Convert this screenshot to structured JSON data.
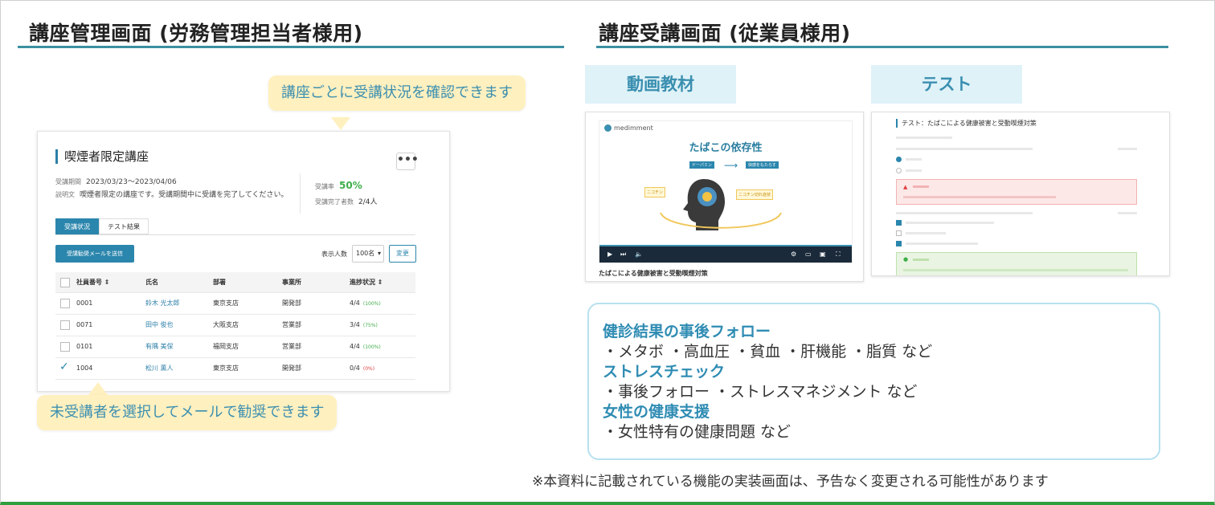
{
  "headings": {
    "admin": "講座管理画面 (労務管理担当者様用)",
    "employee": "講座受講画面 (従業員様用)"
  },
  "admin_card": {
    "course_title": "喫煙者限定講座",
    "more": "•••",
    "period_label": "受講期間",
    "period": "2023/03/23〜2023/04/06",
    "desc_label": "説明文",
    "desc": "喫煙者限定の講座です。受講期間中に受講を完了してください。",
    "rate_label": "受講率",
    "rate": "50%",
    "done_label": "受講完了者数",
    "done": "2/4人",
    "tabs": [
      "受講状況",
      "テスト結果"
    ],
    "mail_button": "受講勧奨メールを送信",
    "display_label": "表示人数",
    "display_value": "100名",
    "change_button": "変更",
    "columns": [
      "社員番号 ⇕",
      "氏名",
      "部署",
      "事業所",
      "進捗状況 ⇕"
    ],
    "rows": [
      {
        "id": "0001",
        "name": "鈴木 光太郎",
        "dept": "東京支店",
        "office": "開発部",
        "progress": "4/4",
        "pct": "(100%)",
        "checked": false
      },
      {
        "id": "0071",
        "name": "田中 俊也",
        "dept": "大阪支店",
        "office": "営業部",
        "progress": "3/4",
        "pct": "(75%)",
        "checked": false
      },
      {
        "id": "0101",
        "name": "有隅 美保",
        "dept": "福岡支店",
        "office": "営業部",
        "progress": "4/4",
        "pct": "(100%)",
        "checked": false
      },
      {
        "id": "1004",
        "name": "松川 薫人",
        "dept": "東京支店",
        "office": "開発部",
        "progress": "0/4",
        "pct": "(0%)",
        "checked": true
      }
    ]
  },
  "callouts": {
    "top": "講座ごとに受講状況を確認できます",
    "bottom": "未受講者を選択してメールで勧奨できます"
  },
  "labels": {
    "video": "動画教材",
    "test": "テスト"
  },
  "video": {
    "logo": "medimment",
    "title": "たばこの依存性",
    "tag1": "ドーパミン",
    "tag2": "快感をもたらす",
    "box1": "ニコチン",
    "box2": "ニコチン切れ症状",
    "caption": "たばこによる健康被害と受動喫煙対策"
  },
  "test": {
    "title": "テスト：たばこによる健康被害と受動喫煙対策"
  },
  "info": {
    "h1": "健診結果の事後フォロー",
    "l1": "・メタボ ・高血圧 ・貧血 ・肝機能 ・脂質 など",
    "h2": "ストレスチェック",
    "l2": "・事後フォロー ・ストレスマネジメント など",
    "h3": "女性の健康支援",
    "l3": "・女性特有の健康問題 など"
  },
  "note": "※本資料に記載されている機能の実装画面は、予告なく変更される可能性があります",
  "colors": {
    "accent": "#3b8fa0",
    "primary_button": "#2b86ad",
    "callout_bg": "#fff0bf",
    "label_bg": "#dff2f8",
    "footer_green": "#2e9e3e"
  }
}
